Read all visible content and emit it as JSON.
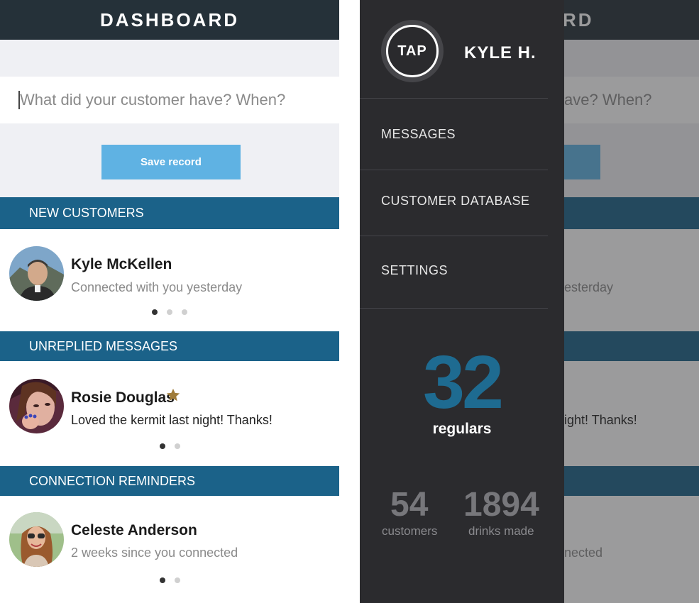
{
  "dashboard": {
    "title": "DASHBOARD",
    "title_partial": "RD",
    "record_input": {
      "placeholder": "What did your customer have? When?",
      "placeholder_partial": "ave? When?"
    },
    "save_button": "Save record",
    "sections": {
      "new_customers": {
        "header": "NEW CUSTOMERS",
        "card": {
          "name": "Kyle McKellen",
          "subtitle": "Connected with you yesterday",
          "subtitle_partial": "esterday",
          "pages": 3,
          "active_page": 1
        }
      },
      "unreplied_messages": {
        "header": "UNREPLIED MESSAGES",
        "card": {
          "name": "Rosie Douglas",
          "message": "Loved the kermit last night! Thanks!",
          "message_partial": "ight! Thanks!",
          "starred": true,
          "pages": 2,
          "active_page": 1
        }
      },
      "connection_reminders": {
        "header": "CONNECTION REMINDERS",
        "card": {
          "name": "Celeste Anderson",
          "subtitle": "2 weeks since you connected",
          "subtitle_partial": "nected",
          "pages": 2,
          "active_page": 1
        }
      }
    }
  },
  "drawer": {
    "logo_text": "TAP",
    "user_name": "KYLE H.",
    "menu": [
      "MESSAGES",
      "CUSTOMER DATABASE",
      "SETTINGS"
    ],
    "regulars": {
      "value": "32",
      "label": "regulars"
    },
    "customers": {
      "value": "54",
      "label": "customers"
    },
    "drinks": {
      "value": "1894",
      "label": "drinks made"
    }
  },
  "colors": {
    "topbar": "#253139",
    "section_header": "#1b6289",
    "save_button": "#5fb2e3",
    "drawer_bg": "#2b2b2e",
    "accent_number": "#1e6b91",
    "star": "#a07c3a"
  },
  "icons": [
    "star-icon",
    "tap-logo"
  ]
}
